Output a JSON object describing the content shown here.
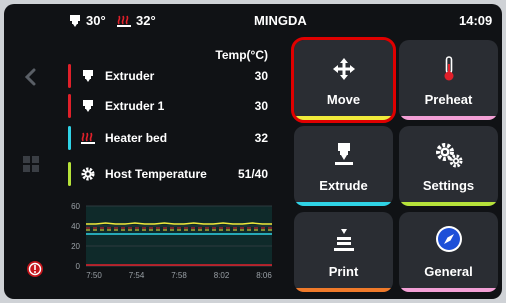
{
  "status_bar": {
    "extruder_temp": "30°",
    "bed_temp": "32°",
    "brand": "MINGDA",
    "time": "14:09"
  },
  "left_rail": {
    "icons": [
      "back-arrow-icon",
      "grid-icon",
      "emergency-stop-icon"
    ]
  },
  "temperature_table": {
    "header": "Temp(°C)",
    "rows": [
      {
        "label": "Extruder",
        "value": "30",
        "color": "#e0202a",
        "icon": "extruder-icon"
      },
      {
        "label": "Extruder 1",
        "value": "30",
        "color": "#e0202a",
        "icon": "extruder-icon"
      },
      {
        "label": "Heater bed",
        "value": "32",
        "color": "#2fd3e6",
        "icon": "heater-bed-icon"
      },
      {
        "label": "Host Temperature",
        "value": "51/40",
        "color": "#b6e23a",
        "icon": "gear-icon"
      }
    ]
  },
  "chart_data": {
    "type": "line",
    "x_ticks": [
      "7:50",
      "7:54",
      "7:58",
      "8:02",
      "8:06"
    ],
    "y_ticks": [
      "0",
      "20",
      "40",
      "60"
    ],
    "ylim": [
      0,
      60
    ],
    "series": [
      {
        "color": "#f1ea3a",
        "values": [
          42,
          42,
          43,
          42,
          42,
          43,
          42,
          42,
          43,
          42,
          42,
          43,
          42,
          42,
          43,
          42,
          42,
          43,
          42,
          42
        ]
      },
      {
        "color": "#2fd3e6",
        "values": [
          32,
          32,
          32,
          32,
          32,
          32,
          32,
          32,
          32,
          32,
          32,
          32,
          32,
          32,
          32,
          32,
          32,
          32,
          32,
          32
        ]
      },
      {
        "color": "#e0202a",
        "values": [
          1,
          1,
          1,
          1,
          1,
          1,
          1,
          1,
          1,
          1,
          1,
          1,
          1,
          1,
          1,
          1,
          1,
          1,
          1,
          1
        ]
      }
    ],
    "targets": [
      {
        "color": "#f1ea3a",
        "value": 36
      },
      {
        "color": "#e0202a",
        "value": 38
      }
    ]
  },
  "tiles": [
    {
      "label": "Move",
      "icon": "move-icon",
      "accent": "#f1ea3a",
      "selected": true
    },
    {
      "label": "Preheat",
      "icon": "thermometer-icon",
      "accent": "#f3a0d6",
      "selected": false
    },
    {
      "label": "Extrude",
      "icon": "nozzle-icon",
      "accent": "#2fd3e6",
      "selected": false
    },
    {
      "label": "Settings",
      "icon": "gears-icon",
      "accent": "#b6e23a",
      "selected": false
    },
    {
      "label": "Print",
      "icon": "print-icon",
      "accent": "#f07a2a",
      "selected": false
    },
    {
      "label": "General",
      "icon": "compass-icon",
      "accent": "#f3a0d6",
      "selected": false
    }
  ]
}
